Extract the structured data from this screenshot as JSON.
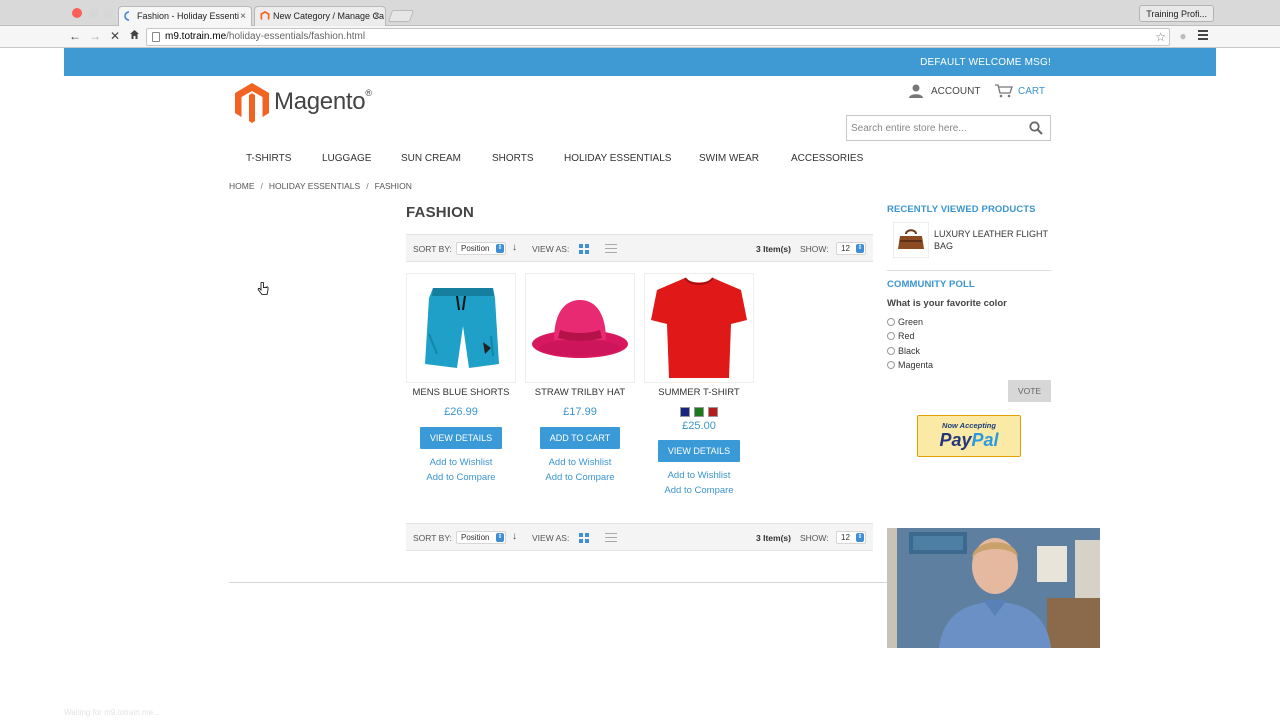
{
  "browser": {
    "tabs": [
      {
        "title": "Fashion - Holiday Essenti"
      },
      {
        "title": "New Category / Manage Ca"
      }
    ],
    "profile_label": "Training Profi...",
    "url_host": "m9.totrain.me",
    "url_path": "/holiday-essentials/fashion.html"
  },
  "site": {
    "welcome": "DEFAULT WELCOME MSG!",
    "logo_text": "Magento",
    "account_label": "ACCOUNT",
    "cart_label": "CART",
    "search_placeholder": "Search entire store here...",
    "nav": [
      "T-SHIRTS",
      "LUGGAGE",
      "SUN CREAM",
      "SHORTS",
      "HOLIDAY ESSENTIALS",
      "SWIM WEAR",
      "ACCESSORIES"
    ],
    "breadcrumb": [
      "HOME",
      "HOLIDAY ESSENTIALS",
      "FASHION"
    ],
    "accent_color": "#3f9ad3",
    "orange_color": "#f26322"
  },
  "page": {
    "title": "FASHION",
    "toolbar": {
      "sort_by_label": "SORT BY:",
      "sort_value": "Position",
      "view_as_label": "VIEW AS:",
      "items_count": "3 Item(s)",
      "show_label": "SHOW:",
      "show_value": "12"
    }
  },
  "products": [
    {
      "name": "MENS BLUE SHORTS",
      "price": "£26.99",
      "button": "VIEW DETAILS",
      "wishlist": "Add to Wishlist",
      "compare": "Add to Compare"
    },
    {
      "name": "STRAW TRILBY HAT",
      "price": "£17.99",
      "button": "ADD TO CART",
      "wishlist": "Add to Wishlist",
      "compare": "Add to Compare"
    },
    {
      "name": "SUMMER T-SHIRT",
      "price": "£25.00",
      "button": "VIEW DETAILS",
      "wishlist": "Add to Wishlist",
      "compare": "Add to Compare",
      "swatches": [
        "#1a237e",
        "#1b7a1b",
        "#b71c1c"
      ]
    }
  ],
  "sidebar": {
    "recent_heading": "RECENTLY VIEWED PRODUCTS",
    "recent_item": "LUXURY LEATHER FLIGHT BAG",
    "poll_heading": "COMMUNITY POLL",
    "poll_question": "What is your favorite color",
    "poll_options": [
      "Green",
      "Red",
      "Black",
      "Magenta"
    ],
    "vote_label": "VOTE",
    "paypal_now": "Now Accepting",
    "paypal_pay": "Pay",
    "paypal_pal": "Pal"
  },
  "status_text": "Waiting for m9.totrain.me..."
}
